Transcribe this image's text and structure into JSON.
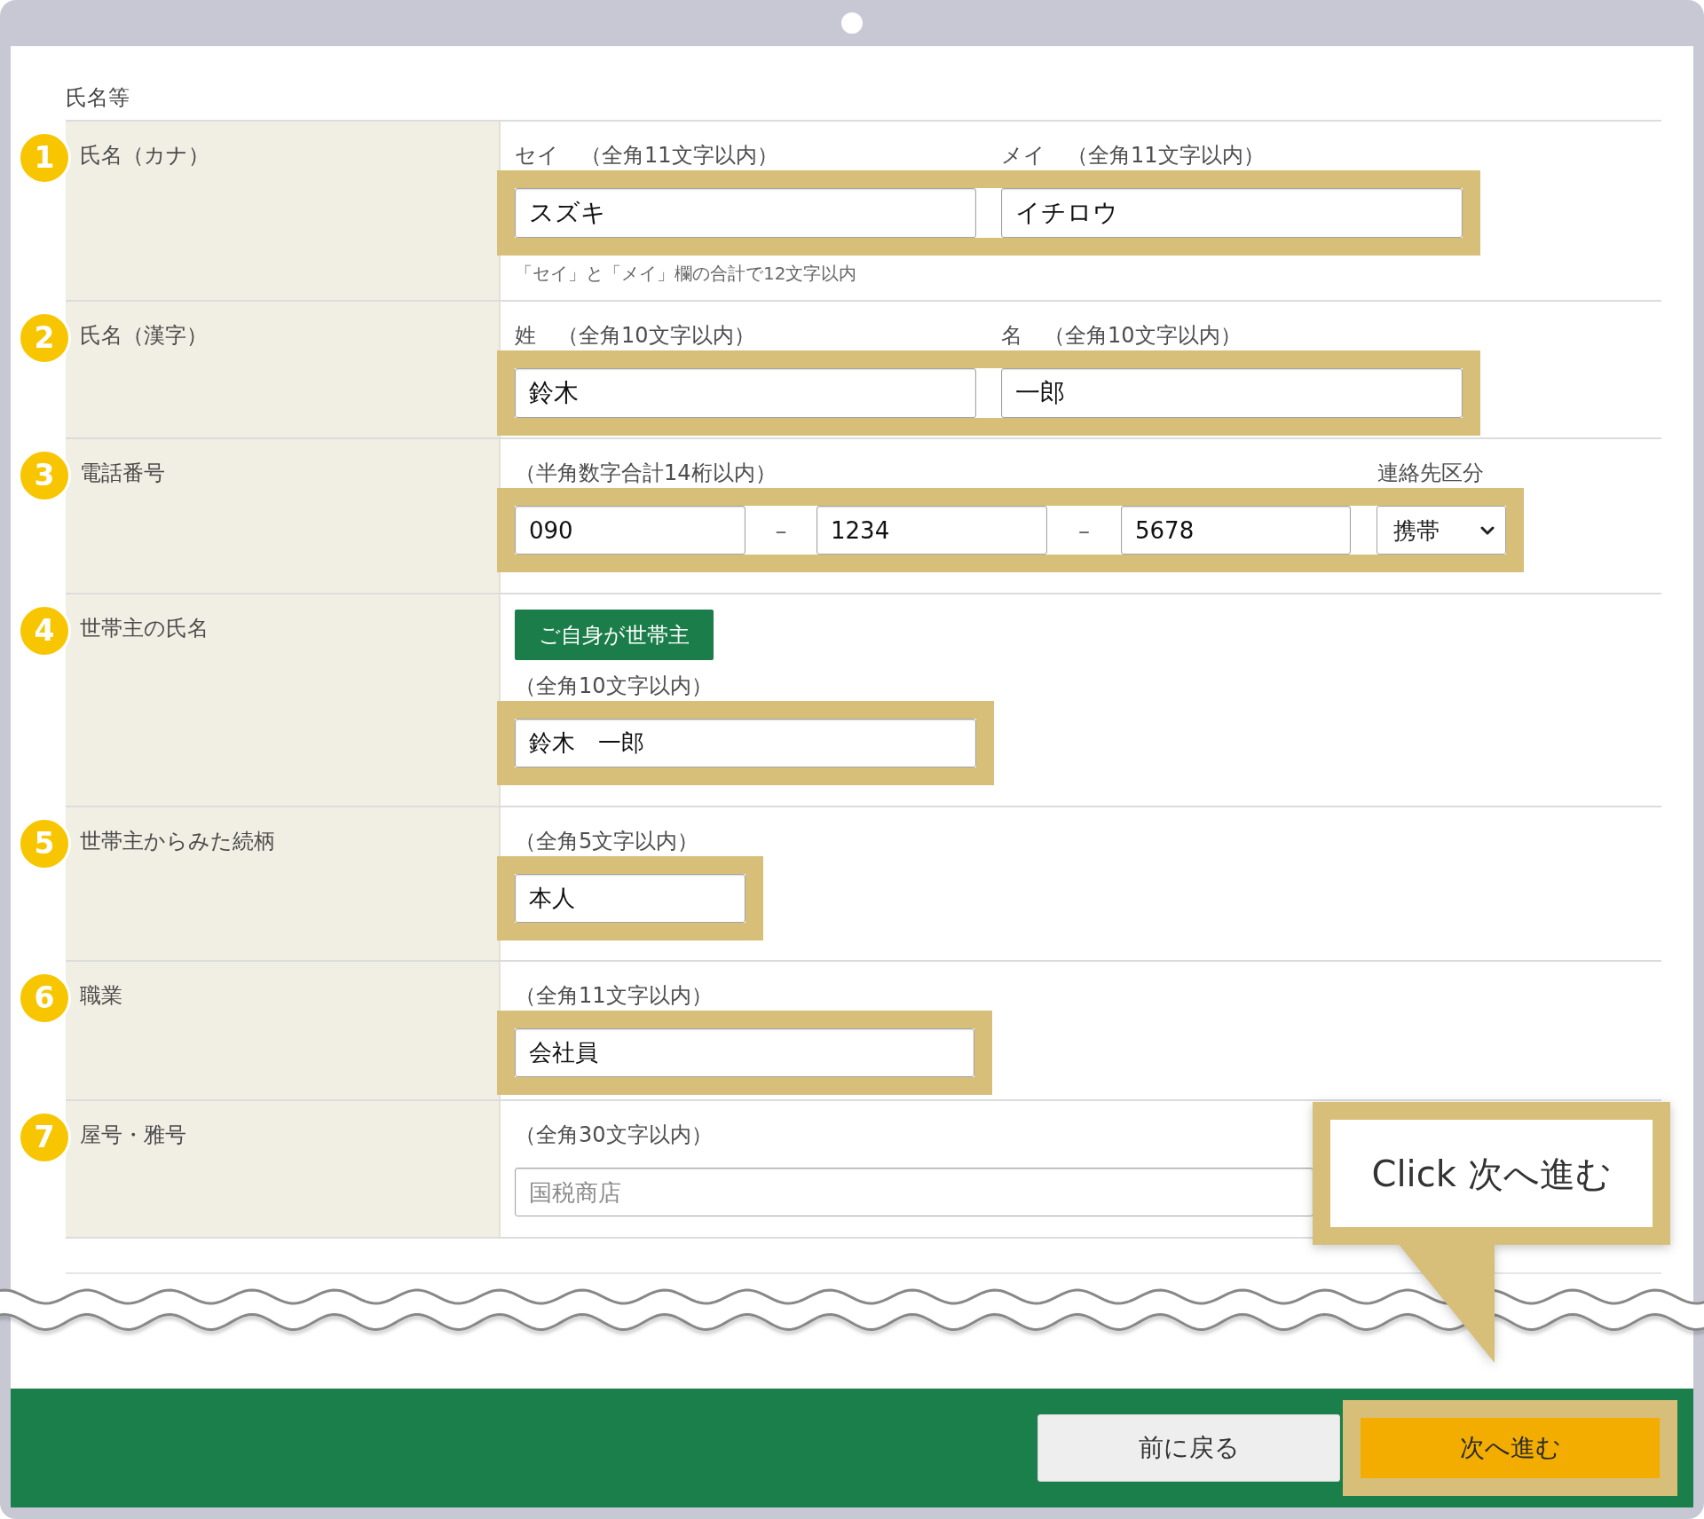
{
  "section_title": "氏名等",
  "rows": [
    {
      "number": "1",
      "label": "氏名（カナ）",
      "kind": "name_pair",
      "highlighted": true,
      "fields": [
        {
          "hint": "セイ　（全角11文字以内）",
          "value": "スズキ"
        },
        {
          "hint": "メイ　（全角11文字以内）",
          "value": "イチロウ"
        }
      ],
      "note": "「セイ」と「メイ」欄の合計で12文字以内"
    },
    {
      "number": "2",
      "label": "氏名（漢字）",
      "kind": "name_pair",
      "highlighted": true,
      "fields": [
        {
          "hint": "姓　（全角10文字以内）",
          "value": "鈴木"
        },
        {
          "hint": "名　（全角10文字以内）",
          "value": "一郎"
        }
      ]
    },
    {
      "number": "3",
      "label": "電話番号",
      "kind": "phone",
      "highlighted": true,
      "hint": "（半角数字合計14桁以内）",
      "fields": [
        {
          "value": "090"
        },
        {
          "value": "1234"
        },
        {
          "value": "5678"
        }
      ],
      "separators": [
        "–",
        "–"
      ],
      "select": {
        "label": "連絡先区分",
        "value": "携帯"
      }
    },
    {
      "number": "4",
      "label": "世帯主の氏名",
      "kind": "text",
      "highlighted": true,
      "button": "ご自身が世帯主",
      "hint": "（全角10文字以内）",
      "field": {
        "value": "鈴木　一郎"
      }
    },
    {
      "number": "5",
      "label": "世帯主からみた続柄",
      "kind": "text",
      "highlighted": true,
      "hint": "（全角5文字以内）",
      "field": {
        "value": "本人"
      }
    },
    {
      "number": "6",
      "label": "職業",
      "kind": "text",
      "highlighted": true,
      "hint": "（全角11文字以内）",
      "field": {
        "value": "会社員"
      }
    },
    {
      "number": "7",
      "label": "屋号・雅号",
      "kind": "text",
      "highlighted": false,
      "hint": "（全角30文字以内）",
      "field": {
        "placeholder": "国税商店"
      }
    }
  ],
  "callout": {
    "text": "Click 次へ進む"
  },
  "footer": {
    "buttons": [
      {
        "label": "前に戻る",
        "kind": "secondary",
        "highlighted": false
      },
      {
        "label": "次へ進む",
        "kind": "primary",
        "highlighted": true
      }
    ]
  }
}
